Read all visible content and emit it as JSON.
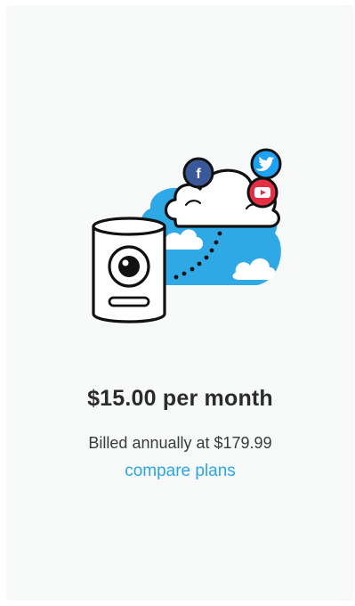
{
  "plan": {
    "price_text": "$15.00 per month",
    "billing_text": "Billed annually at $179.99",
    "compare_link": "compare plans"
  },
  "icons": {
    "camera": "camera-icon",
    "cloud": "cloud-icon",
    "facebook": "facebook-icon",
    "twitter": "twitter-icon",
    "youtube": "youtube-icon"
  },
  "colors": {
    "accent_blue": "#2aa7e6",
    "sky_blue": "#2fa8e6",
    "facebook": "#3b5998",
    "twitter": "#1da1f2",
    "youtube": "#e62e45",
    "text_dark": "#2b2b2b",
    "background": "#f7f8f8"
  }
}
